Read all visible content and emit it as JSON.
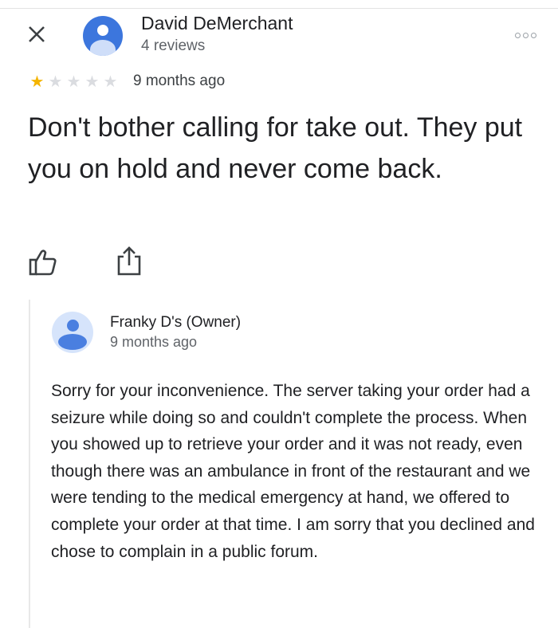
{
  "review": {
    "author_name": "David DeMerchant",
    "author_meta": "4 reviews",
    "rating": 1,
    "max_rating": 5,
    "date": "9 months ago",
    "text": "Don't bother calling for take out. They put you on hold and never come back."
  },
  "owner_reply": {
    "author_name": "Franky D's (Owner)",
    "date": "9 months ago",
    "text": "Sorry for your inconvenience.  The server taking your order had a seizure while doing so and couldn't complete the process.  When you showed up to retrieve your order and it was not ready, even though there was an ambulance in front of the restaurant and we were tending to the medical emergency at hand, we offered to complete your order at that time.  I am sorry that you declined and chose to complain in a public forum."
  },
  "icons": {
    "close": "close-icon",
    "more": "more-options-icon",
    "like": "thumbs-up-icon",
    "share": "share-icon",
    "avatar": "default-avatar-icon"
  },
  "colors": {
    "star_filled": "#f4b400",
    "star_empty": "#dadce0",
    "avatar_main": "#3c76dd",
    "avatar_owner_bg": "#d6e4fb",
    "avatar_owner_fg": "#4a7fe0",
    "secondary_text": "#5f6368"
  }
}
